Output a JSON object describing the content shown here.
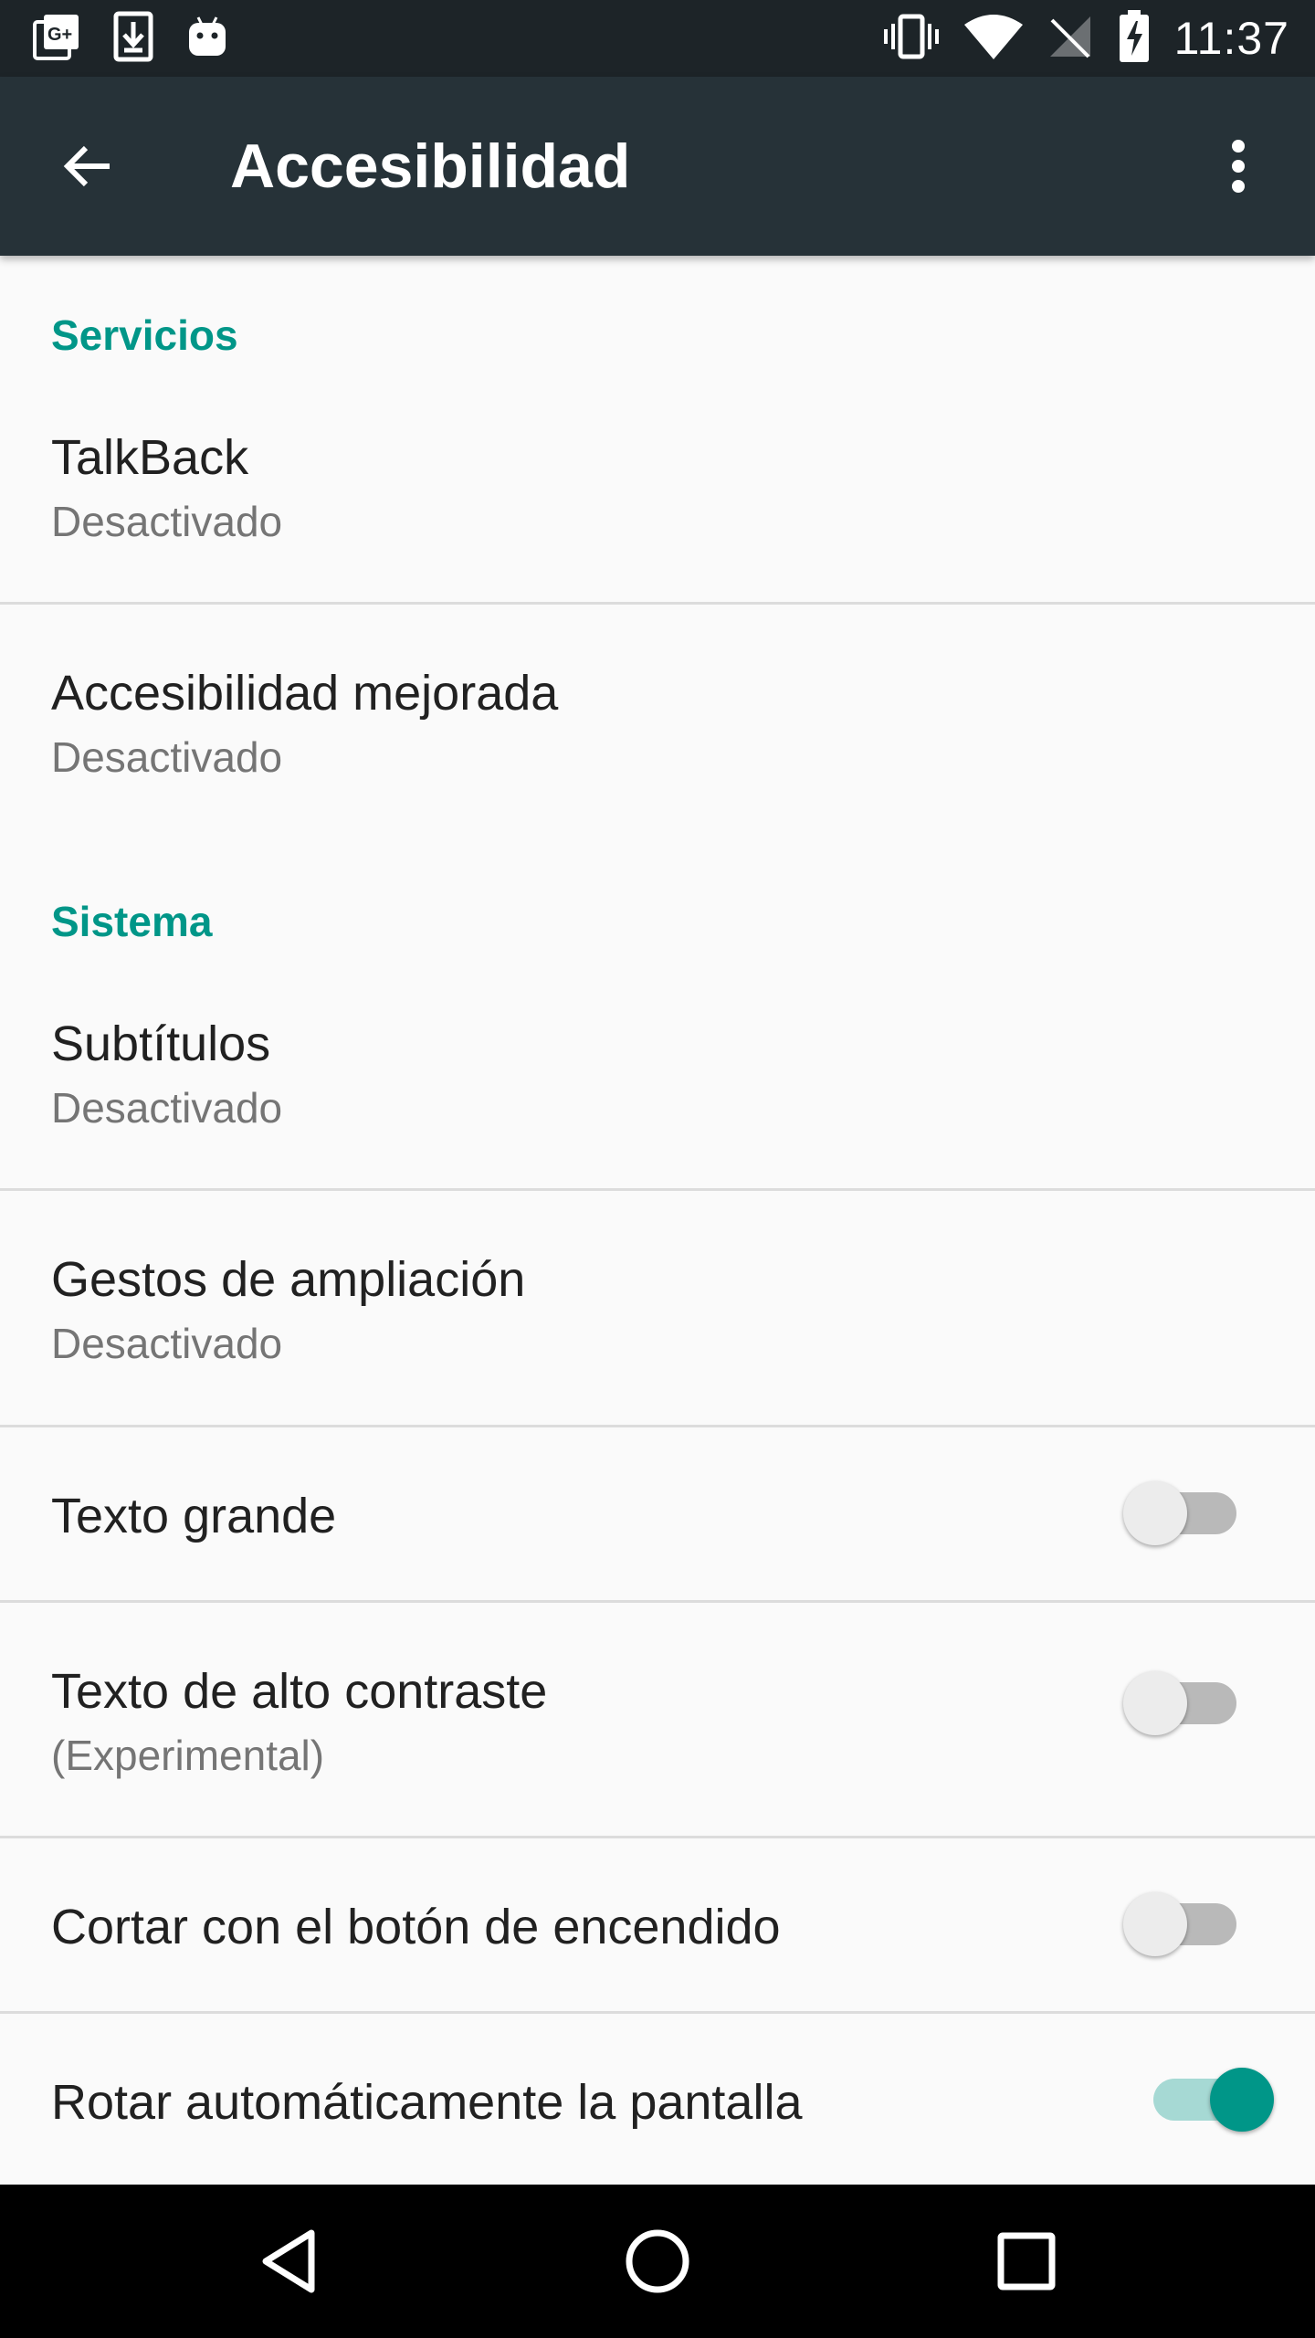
{
  "status_bar": {
    "time": "11:37",
    "left_icons": [
      "google-plus-notification-icon",
      "download-icon",
      "android-icon"
    ],
    "right_icons": [
      "vibrate-icon",
      "wifi-icon",
      "no-signal-icon",
      "battery-charging-icon"
    ]
  },
  "toolbar": {
    "title": "Accesibilidad",
    "back_icon": "arrow-back-icon",
    "overflow_icon": "more-vert-icon",
    "background": "#263238"
  },
  "sections": {
    "services": {
      "header": "Servicios",
      "items": [
        {
          "title": "TalkBack",
          "summary": "Desactivado"
        },
        {
          "title": "Accesibilidad mejorada",
          "summary": "Desactivado"
        }
      ]
    },
    "system": {
      "header": "Sistema",
      "items": [
        {
          "title": "Subtítulos",
          "summary": "Desactivado"
        },
        {
          "title": "Gestos de ampliación",
          "summary": "Desactivado"
        },
        {
          "title": "Texto grande",
          "checked": false
        },
        {
          "title": "Texto de alto contraste",
          "summary": "(Experimental)",
          "checked": false
        },
        {
          "title": "Cortar con el botón de encendido",
          "checked": false
        },
        {
          "title": "Rotar automáticamente la pantalla",
          "checked": true
        }
      ]
    }
  },
  "nav_bar": {
    "buttons": [
      "back-triangle-icon",
      "home-circle-icon",
      "recents-square-icon"
    ]
  },
  "colors": {
    "accent": "#009688",
    "status_bar": "#1d2428",
    "background": "#fafafa",
    "nav_bar": "#000000"
  }
}
